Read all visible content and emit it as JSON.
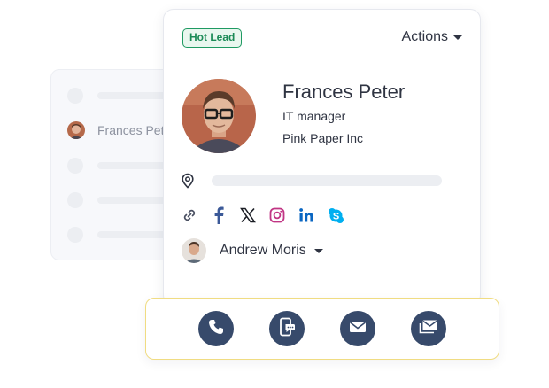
{
  "background_list": {
    "visible_name": "Frances Pet"
  },
  "contact_card": {
    "badge": "Hot Lead",
    "actions_label": "Actions",
    "name": "Frances Peter",
    "job_title": "IT manager",
    "company": "Pink Paper Inc",
    "social_icons": [
      "link-icon",
      "facebook-icon",
      "x-icon",
      "instagram-icon",
      "linkedin-icon",
      "skype-icon"
    ],
    "owner": {
      "name": "Andrew Moris"
    }
  },
  "action_bar": {
    "buttons": [
      "phone-icon",
      "sms-icon",
      "email-icon",
      "bulk-email-icon"
    ]
  },
  "colors": {
    "badge_green": "#1f9a62",
    "button_navy": "#374a6b",
    "action_bar_border": "#f0dc82",
    "facebook": "#3b5998",
    "linkedin": "#0a66c2",
    "instagram": "#c13584",
    "skype": "#00aff0"
  }
}
